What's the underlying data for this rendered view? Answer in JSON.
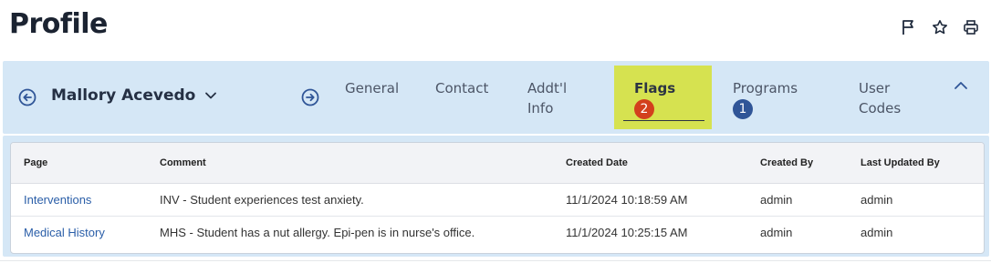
{
  "page": {
    "title": "Profile"
  },
  "actions": {
    "flag_icon": "flag-icon",
    "star_icon": "star-icon",
    "print_icon": "print-icon"
  },
  "student": {
    "name": "Mallory Acevedo"
  },
  "tabs": [
    {
      "label": "General",
      "badge": ""
    },
    {
      "label": "Contact",
      "badge": ""
    },
    {
      "label": "Addt'l Info",
      "badge": ""
    },
    {
      "label": "Flags",
      "badge": "2",
      "active": true
    },
    {
      "label": "Programs",
      "badge": "1"
    },
    {
      "label": "User Codes",
      "badge": ""
    }
  ],
  "colors": {
    "banner": "#d5e7f6",
    "active_tab": "#d6e250",
    "badge_red": "#d3401d",
    "badge_blue": "#2f5597",
    "link": "#2a5ea8"
  },
  "table": {
    "columns": [
      "Page",
      "Comment",
      "Created Date",
      "Created By",
      "Last Updated By"
    ],
    "rows": [
      [
        "Interventions",
        "INV - Student experiences test anxiety.",
        "11/1/2024 10:18:59 AM",
        "admin",
        "admin"
      ],
      [
        "Medical History",
        "MHS - Student has a nut allergy. Epi-pen is in nurse's office.",
        "11/1/2024 10:25:15 AM",
        "admin",
        "admin"
      ]
    ]
  }
}
